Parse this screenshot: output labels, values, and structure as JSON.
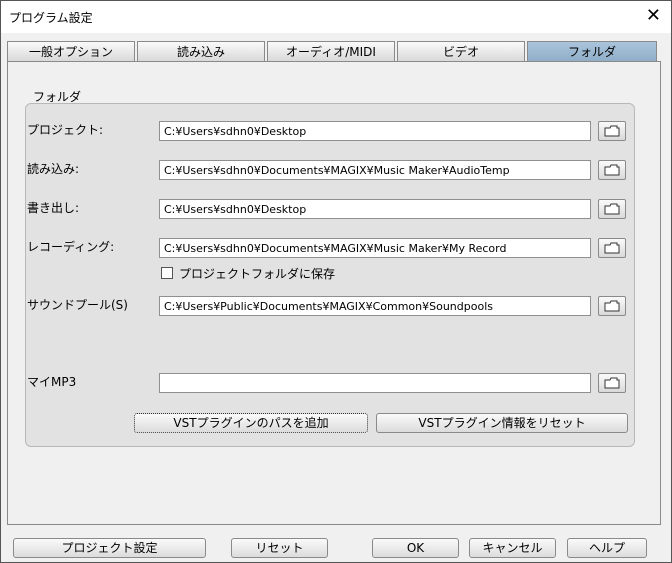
{
  "window": {
    "title": "プログラム設定",
    "close_glyph": "✕"
  },
  "tabs": [
    {
      "label": "一般オプション"
    },
    {
      "label": "読み込み"
    },
    {
      "label": "オーディオ/MIDI"
    },
    {
      "label": "ビデオ"
    },
    {
      "label": "フォルダ",
      "active": true
    }
  ],
  "folders": {
    "group_title": "フォルダ",
    "rows": [
      {
        "label": "プロジェクト:",
        "value": "C:¥Users¥sdhn0¥Desktop"
      },
      {
        "label": "読み込み:",
        "value": "C:¥Users¥sdhn0¥Documents¥MAGIX¥Music Maker¥AudioTemp"
      },
      {
        "label": "書き出し:",
        "value": "C:¥Users¥sdhn0¥Desktop"
      },
      {
        "label": "レコーディング:",
        "value": "C:¥Users¥sdhn0¥Documents¥MAGIX¥Music Maker¥My Record"
      },
      {
        "label": "サウンドプール(S)",
        "value": "C:¥Users¥Public¥Documents¥MAGIX¥Common¥Soundpools"
      },
      {
        "label": "マイMP3",
        "value": ""
      }
    ],
    "checkbox_label": "プロジェクトフォルダに保存",
    "checkbox_checked": false,
    "vst_add_path": "VSTプラグインのパスを追加",
    "vst_reset": "VSTプラグイン情報をリセット"
  },
  "footer": {
    "project_settings": "プロジェクト設定",
    "reset": "リセット",
    "ok": "OK",
    "cancel": "キャンセル",
    "help": "ヘルプ"
  }
}
